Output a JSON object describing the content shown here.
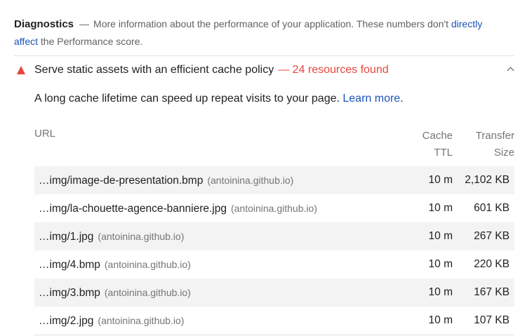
{
  "diagnostics": {
    "title": "Diagnostics",
    "dash": "—",
    "description_prefix": "More information about the performance of your application. These numbers don't ",
    "link_text": "directly affect",
    "description_suffix": " the Performance score."
  },
  "audit": {
    "icon": "warning-triangle-icon",
    "title": "Serve static assets with an efficient cache policy",
    "summary": "— 24 resources found",
    "description": "A long cache lifetime can speed up repeat visits to your page. ",
    "learn_more": "Learn more",
    "period": "."
  },
  "table": {
    "headers": {
      "url": "URL",
      "cache_ttl_line1": "Cache",
      "cache_ttl_line2": "TTL",
      "transfer_size_line1": "Transfer",
      "transfer_size_line2": "Size"
    },
    "rows": [
      {
        "url": "…img/image-de-presentation.bmp",
        "host": "(antoinina.github.io)",
        "ttl": "10 m",
        "size": "2,102 KB"
      },
      {
        "url": "…img/la-chouette-agence-banniere.jpg",
        "host": "(antoinina.github.io)",
        "ttl": "10 m",
        "size": "601 KB"
      },
      {
        "url": "…img/1.jpg",
        "host": "(antoinina.github.io)",
        "ttl": "10 m",
        "size": "267 KB"
      },
      {
        "url": "…img/4.bmp",
        "host": "(antoinina.github.io)",
        "ttl": "10 m",
        "size": "220 KB"
      },
      {
        "url": "…img/3.bmp",
        "host": "(antoinina.github.io)",
        "ttl": "10 m",
        "size": "167 KB"
      },
      {
        "url": "…img/2.jpg",
        "host": "(antoinina.github.io)",
        "ttl": "10 m",
        "size": "107 KB"
      }
    ]
  },
  "colors": {
    "fail": "#e8453c",
    "link": "#1a53b8",
    "row_alt_bg": "#f3f3f3"
  }
}
